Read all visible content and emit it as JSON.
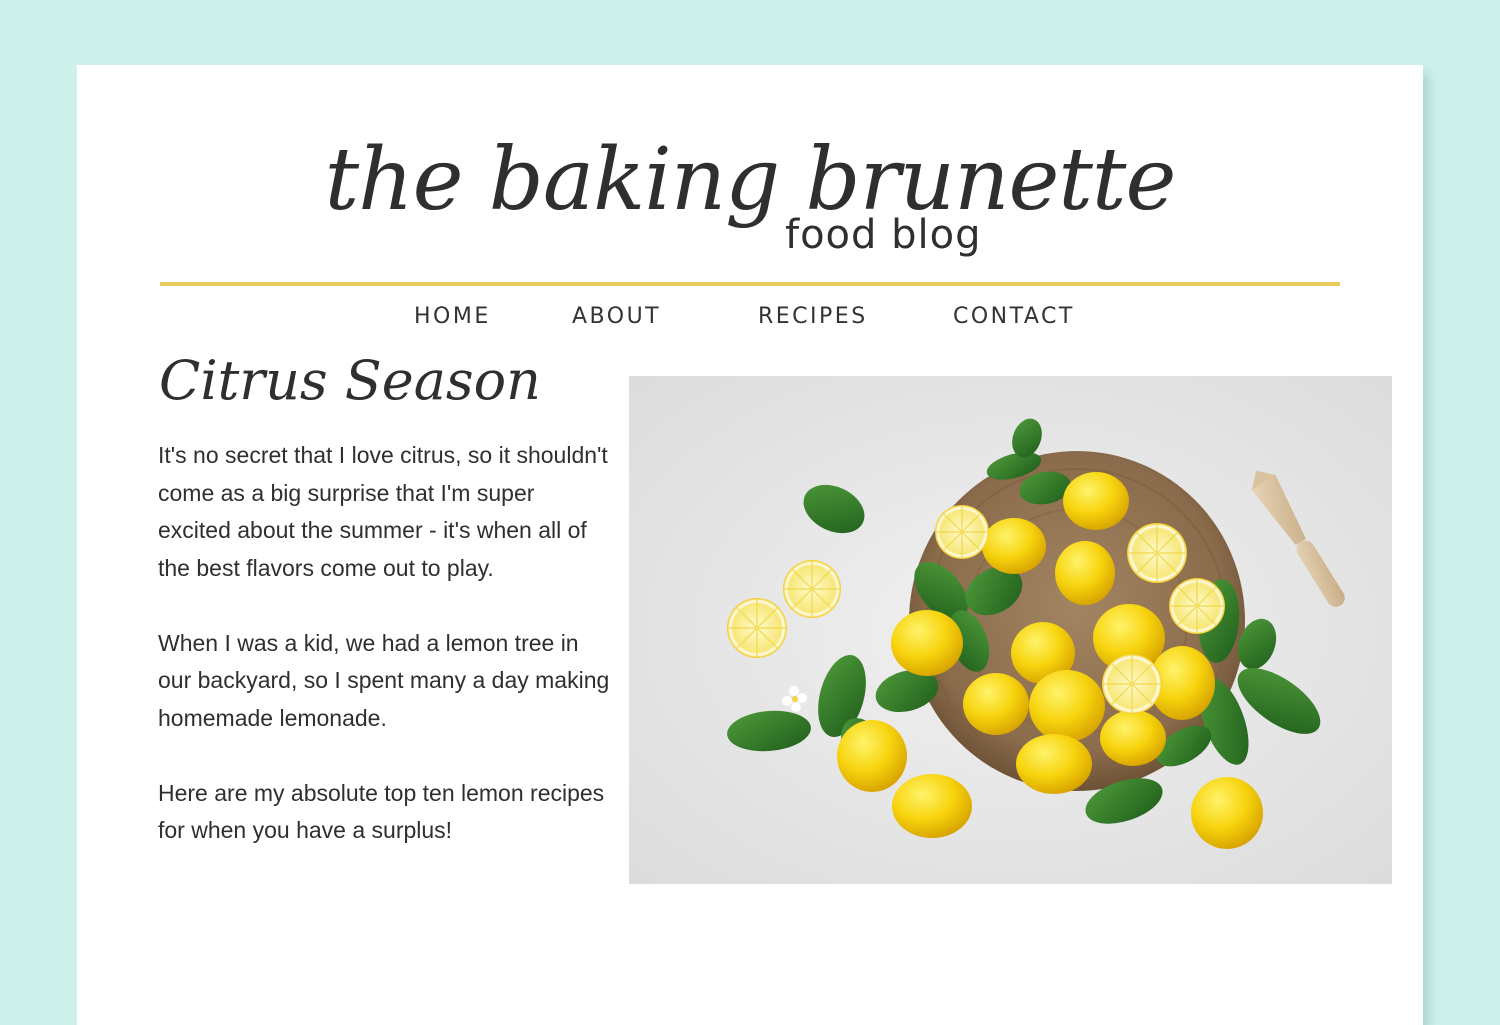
{
  "blog": {
    "title": "the baking brunette",
    "subtitle": "food blog",
    "accent_color": "#e9c95a",
    "background_color": "#cff1ec"
  },
  "nav": {
    "items": [
      {
        "label": "HOME"
      },
      {
        "label": "ABOUT"
      },
      {
        "label": "RECIPES"
      },
      {
        "label": "CONTACT"
      }
    ]
  },
  "post": {
    "title": "Citrus Season",
    "paragraphs": [
      "It's no secret that I love citrus, so it shouldn't come as a big surprise that I'm super excited about the summer - it's when all of the best flavors come out to play.",
      "When I was a kid, we had a lemon tree in our backyard, so I spent many a day making homemade lemonade.",
      "Here are my absolute top ten lemon recipes for when you have a surplus!"
    ]
  },
  "hero_image": {
    "icon": "lemons-on-wooden-board-photo"
  }
}
